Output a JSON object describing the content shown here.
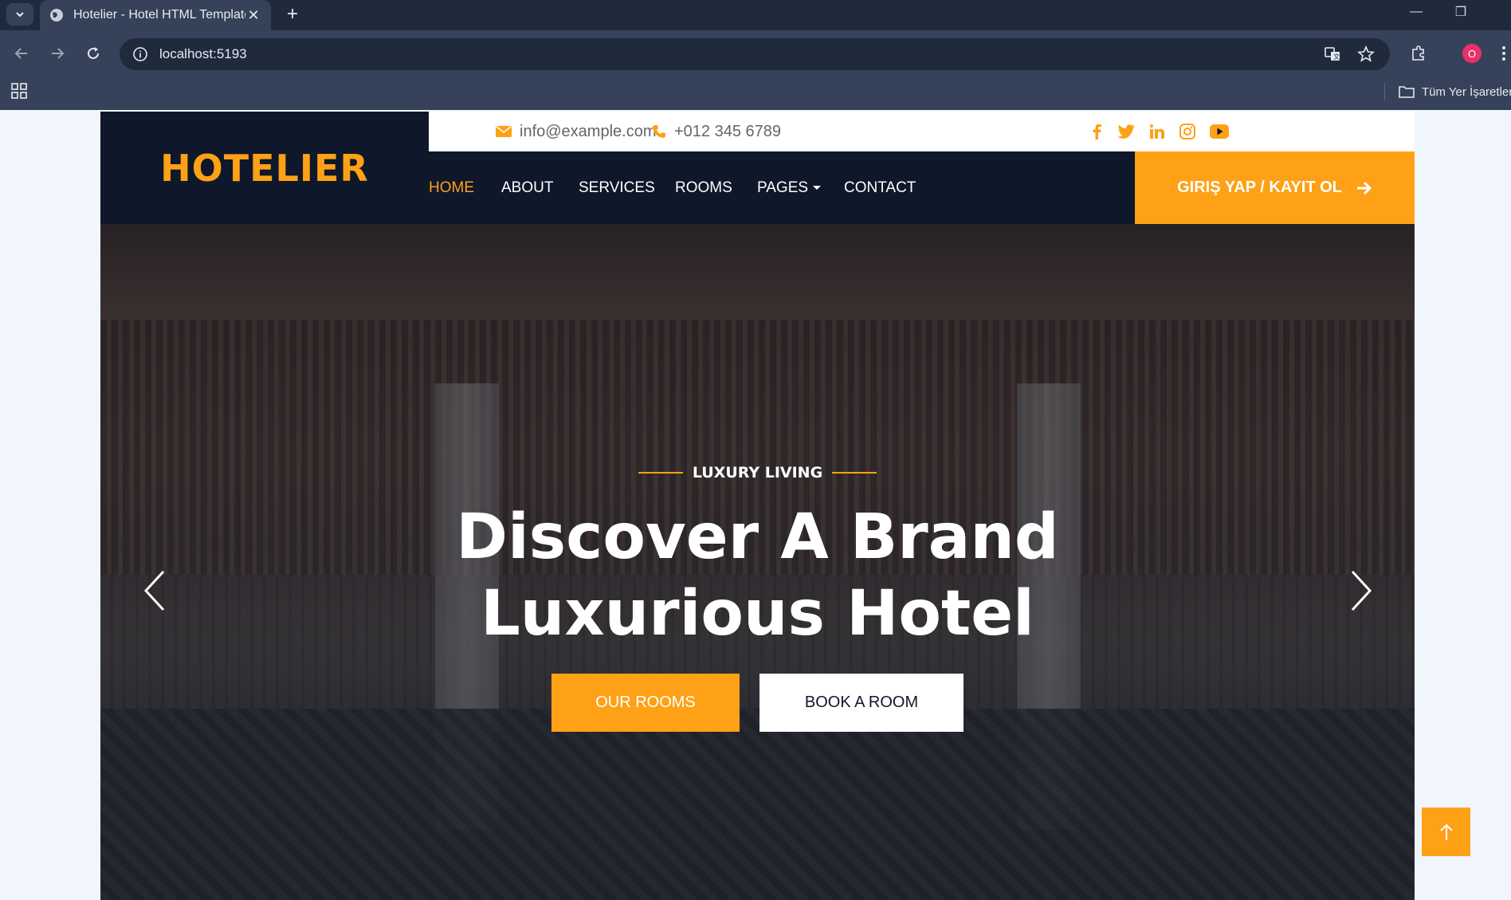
{
  "browser": {
    "tab_title": "Hotelier - Hotel HTML Template",
    "url": "localhost:5193",
    "profile_initial": "O",
    "bookmarks_label": "Tüm Yer İşaretleri"
  },
  "site": {
    "logo": "HOTELIER",
    "email": "info@example.com",
    "phone": "+012 345 6789",
    "social_icons": [
      "facebook-icon",
      "twitter-icon",
      "linkedin-icon",
      "instagram-icon",
      "youtube-icon"
    ],
    "nav": [
      {
        "label": "Home",
        "active": true
      },
      {
        "label": "About"
      },
      {
        "label": "Services"
      },
      {
        "label": "Rooms"
      },
      {
        "label": "Pages",
        "dropdown": true
      },
      {
        "label": "Contact"
      }
    ],
    "login_label": "GIRIŞ YAP / KAYIT OL",
    "hero": {
      "kicker": "Luxury Living",
      "title_line1": "Discover A Brand",
      "title_line2": "Luxurious Hotel",
      "primary_button": "Our Rooms",
      "secondary_button": "Book A Room"
    }
  },
  "colors": {
    "accent": "#FEA116",
    "dark": "#0F172B"
  }
}
